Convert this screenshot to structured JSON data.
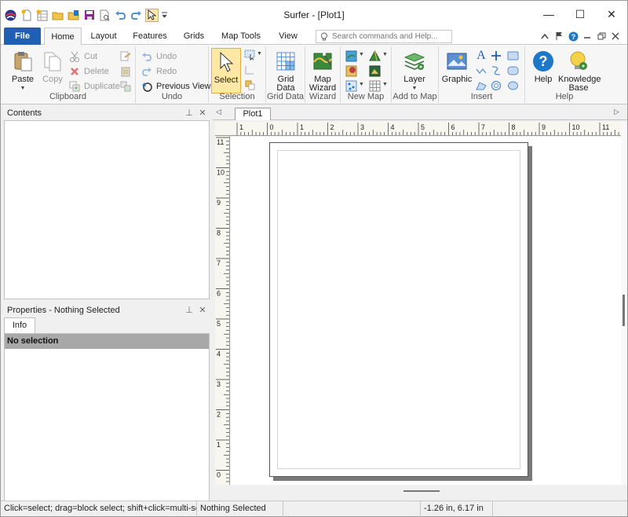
{
  "window": {
    "title": "Surfer - [Plot1]",
    "controls": {
      "minimize": "—",
      "maximize": "☐",
      "close": "✕"
    }
  },
  "quick_access": {
    "icons": [
      "surfer-logo-icon",
      "new-icon",
      "new-worksheet-icon",
      "open-icon",
      "open-file-icon",
      "save-icon",
      "print-preview-icon",
      "undo-icon",
      "redo-icon",
      "select-icon",
      "customize-dropdown-icon"
    ]
  },
  "ribbon_tabs": [
    "File",
    "Home",
    "Layout",
    "Features",
    "Grids",
    "Map Tools",
    "View"
  ],
  "active_tab": "Home",
  "search": {
    "placeholder": "Search commands and Help..."
  },
  "ribbon": {
    "clipboard": {
      "label": "Clipboard",
      "paste": "Paste",
      "copy": "Copy",
      "cut": "Cut",
      "delete": "Delete",
      "duplicate": "Duplicate"
    },
    "undo": {
      "label": "Undo",
      "undo": "Undo",
      "redo": "Redo",
      "previous_view": "Previous View"
    },
    "selection": {
      "label": "Selection",
      "select": "Select"
    },
    "grid_data": {
      "label": "Grid Data",
      "line1": "Grid",
      "line2": "Data"
    },
    "wizard": {
      "label": "Wizard",
      "line1": "Map",
      "line2": "Wizard"
    },
    "new_map": {
      "label": "New Map"
    },
    "add_to_map": {
      "label": "Add to Map",
      "layer": "Layer"
    },
    "insert": {
      "label": "Insert",
      "graphic": "Graphic"
    },
    "help": {
      "label": "Help",
      "help": "Help",
      "kb_line1": "Knowledge",
      "kb_line2": "Base"
    }
  },
  "panels": {
    "contents": {
      "title": "Contents"
    },
    "properties": {
      "title": "Properties - Nothing Selected",
      "tab": "Info",
      "selection_text": "No selection"
    }
  },
  "document": {
    "tab": "Plot1",
    "ruler_h_labels": [
      "1",
      "0",
      "1",
      "2",
      "3",
      "4",
      "5",
      "6",
      "7",
      "8",
      "9",
      "10",
      "11"
    ],
    "ruler_v_labels": [
      "11",
      "10",
      "9",
      "8",
      "7",
      "6",
      "5",
      "4",
      "3",
      "2",
      "1",
      "0"
    ]
  },
  "status": {
    "hint": "Click=select; drag=block select; shift+click=multi-se...",
    "selection": "Nothing Selected",
    "coords": "-1.26 in, 6.17 in"
  },
  "colors": {
    "file_tab": "#1f5fb4",
    "select_highlight": "#ffe8a6",
    "accent_blue": "#1e78c8"
  }
}
